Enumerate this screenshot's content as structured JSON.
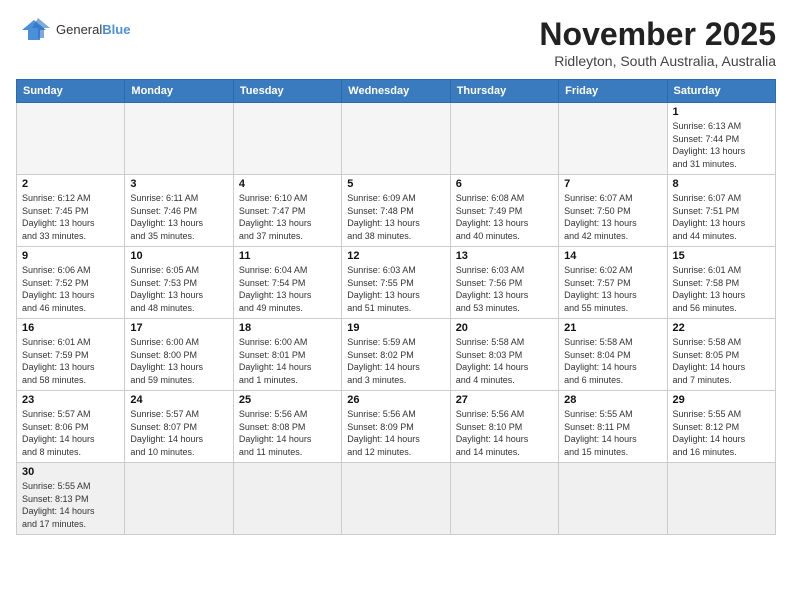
{
  "header": {
    "logo_line1": "General",
    "logo_line2": "Blue",
    "month": "November 2025",
    "location": "Ridleyton, South Australia, Australia"
  },
  "days_of_week": [
    "Sunday",
    "Monday",
    "Tuesday",
    "Wednesday",
    "Thursday",
    "Friday",
    "Saturday"
  ],
  "weeks": [
    [
      {
        "day": "",
        "info": ""
      },
      {
        "day": "",
        "info": ""
      },
      {
        "day": "",
        "info": ""
      },
      {
        "day": "",
        "info": ""
      },
      {
        "day": "",
        "info": ""
      },
      {
        "day": "",
        "info": ""
      },
      {
        "day": "1",
        "info": "Sunrise: 6:13 AM\nSunset: 7:44 PM\nDaylight: 13 hours\nand 31 minutes."
      }
    ],
    [
      {
        "day": "2",
        "info": "Sunrise: 6:12 AM\nSunset: 7:45 PM\nDaylight: 13 hours\nand 33 minutes."
      },
      {
        "day": "3",
        "info": "Sunrise: 6:11 AM\nSunset: 7:46 PM\nDaylight: 13 hours\nand 35 minutes."
      },
      {
        "day": "4",
        "info": "Sunrise: 6:10 AM\nSunset: 7:47 PM\nDaylight: 13 hours\nand 37 minutes."
      },
      {
        "day": "5",
        "info": "Sunrise: 6:09 AM\nSunset: 7:48 PM\nDaylight: 13 hours\nand 38 minutes."
      },
      {
        "day": "6",
        "info": "Sunrise: 6:08 AM\nSunset: 7:49 PM\nDaylight: 13 hours\nand 40 minutes."
      },
      {
        "day": "7",
        "info": "Sunrise: 6:07 AM\nSunset: 7:50 PM\nDaylight: 13 hours\nand 42 minutes."
      },
      {
        "day": "8",
        "info": "Sunrise: 6:07 AM\nSunset: 7:51 PM\nDaylight: 13 hours\nand 44 minutes."
      }
    ],
    [
      {
        "day": "9",
        "info": "Sunrise: 6:06 AM\nSunset: 7:52 PM\nDaylight: 13 hours\nand 46 minutes."
      },
      {
        "day": "10",
        "info": "Sunrise: 6:05 AM\nSunset: 7:53 PM\nDaylight: 13 hours\nand 48 minutes."
      },
      {
        "day": "11",
        "info": "Sunrise: 6:04 AM\nSunset: 7:54 PM\nDaylight: 13 hours\nand 49 minutes."
      },
      {
        "day": "12",
        "info": "Sunrise: 6:03 AM\nSunset: 7:55 PM\nDaylight: 13 hours\nand 51 minutes."
      },
      {
        "day": "13",
        "info": "Sunrise: 6:03 AM\nSunset: 7:56 PM\nDaylight: 13 hours\nand 53 minutes."
      },
      {
        "day": "14",
        "info": "Sunrise: 6:02 AM\nSunset: 7:57 PM\nDaylight: 13 hours\nand 55 minutes."
      },
      {
        "day": "15",
        "info": "Sunrise: 6:01 AM\nSunset: 7:58 PM\nDaylight: 13 hours\nand 56 minutes."
      }
    ],
    [
      {
        "day": "16",
        "info": "Sunrise: 6:01 AM\nSunset: 7:59 PM\nDaylight: 13 hours\nand 58 minutes."
      },
      {
        "day": "17",
        "info": "Sunrise: 6:00 AM\nSunset: 8:00 PM\nDaylight: 13 hours\nand 59 minutes."
      },
      {
        "day": "18",
        "info": "Sunrise: 6:00 AM\nSunset: 8:01 PM\nDaylight: 14 hours\nand 1 minutes."
      },
      {
        "day": "19",
        "info": "Sunrise: 5:59 AM\nSunset: 8:02 PM\nDaylight: 14 hours\nand 3 minutes."
      },
      {
        "day": "20",
        "info": "Sunrise: 5:58 AM\nSunset: 8:03 PM\nDaylight: 14 hours\nand 4 minutes."
      },
      {
        "day": "21",
        "info": "Sunrise: 5:58 AM\nSunset: 8:04 PM\nDaylight: 14 hours\nand 6 minutes."
      },
      {
        "day": "22",
        "info": "Sunrise: 5:58 AM\nSunset: 8:05 PM\nDaylight: 14 hours\nand 7 minutes."
      }
    ],
    [
      {
        "day": "23",
        "info": "Sunrise: 5:57 AM\nSunset: 8:06 PM\nDaylight: 14 hours\nand 8 minutes."
      },
      {
        "day": "24",
        "info": "Sunrise: 5:57 AM\nSunset: 8:07 PM\nDaylight: 14 hours\nand 10 minutes."
      },
      {
        "day": "25",
        "info": "Sunrise: 5:56 AM\nSunset: 8:08 PM\nDaylight: 14 hours\nand 11 minutes."
      },
      {
        "day": "26",
        "info": "Sunrise: 5:56 AM\nSunset: 8:09 PM\nDaylight: 14 hours\nand 12 minutes."
      },
      {
        "day": "27",
        "info": "Sunrise: 5:56 AM\nSunset: 8:10 PM\nDaylight: 14 hours\nand 14 minutes."
      },
      {
        "day": "28",
        "info": "Sunrise: 5:55 AM\nSunset: 8:11 PM\nDaylight: 14 hours\nand 15 minutes."
      },
      {
        "day": "29",
        "info": "Sunrise: 5:55 AM\nSunset: 8:12 PM\nDaylight: 14 hours\nand 16 minutes."
      }
    ],
    [
      {
        "day": "30",
        "info": "Sunrise: 5:55 AM\nSunset: 8:13 PM\nDaylight: 14 hours\nand 17 minutes."
      },
      {
        "day": "",
        "info": ""
      },
      {
        "day": "",
        "info": ""
      },
      {
        "day": "",
        "info": ""
      },
      {
        "day": "",
        "info": ""
      },
      {
        "day": "",
        "info": ""
      },
      {
        "day": "",
        "info": ""
      }
    ]
  ]
}
